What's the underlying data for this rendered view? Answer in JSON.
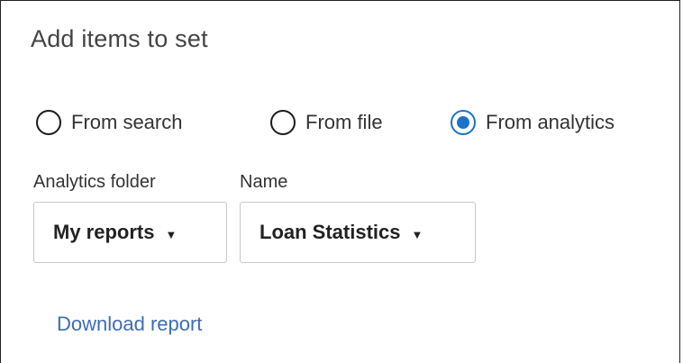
{
  "dialog": {
    "title": "Add items to set"
  },
  "source_options": [
    {
      "label": "From search",
      "selected": false
    },
    {
      "label": "From file",
      "selected": false
    },
    {
      "label": "From analytics",
      "selected": true
    }
  ],
  "analytics_folder": {
    "label": "Analytics folder",
    "value": "My reports",
    "arrow_icon": "caret-down-icon"
  },
  "report_name": {
    "label": "Name",
    "value": "Loan Statistics",
    "arrow_icon": "caret-down-icon"
  },
  "download_link": {
    "label": "Download report"
  },
  "colors": {
    "accent": "#1a73c8",
    "link": "#3d6cb9",
    "border": "#c8c8c8"
  }
}
